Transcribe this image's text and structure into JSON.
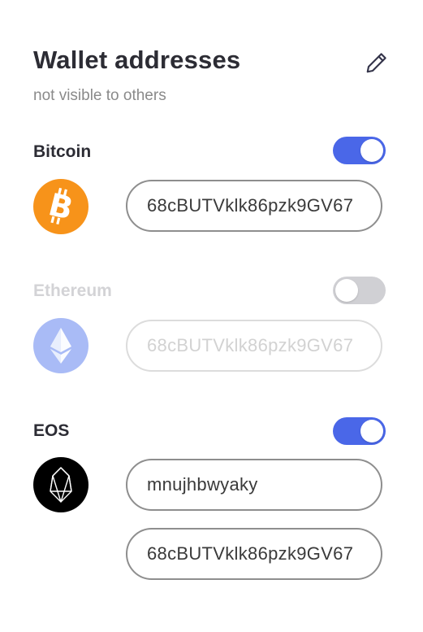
{
  "header": {
    "title": "Wallet addresses",
    "subtitle": "not visible to others",
    "edit_icon": "pencil-icon"
  },
  "colors": {
    "accent": "#4a67e8",
    "bitcoin": "#f7931a",
    "ethereum": "#a9bbf6",
    "eos": "#000000",
    "text": "#2c2c34",
    "muted": "#8a8a8a",
    "disabled_text": "#d3d3d6"
  },
  "wallets": [
    {
      "name": "Bitcoin",
      "enabled": true,
      "icon": "bitcoin-icon",
      "addresses": [
        "68cBUTVklk86pzk9GV67"
      ]
    },
    {
      "name": "Ethereum",
      "enabled": false,
      "icon": "ethereum-icon",
      "addresses": [
        "68cBUTVklk86pzk9GV67"
      ]
    },
    {
      "name": "EOS",
      "enabled": true,
      "icon": "eos-icon",
      "addresses": [
        "mnujhbwyaky",
        "68cBUTVklk86pzk9GV67"
      ]
    }
  ]
}
